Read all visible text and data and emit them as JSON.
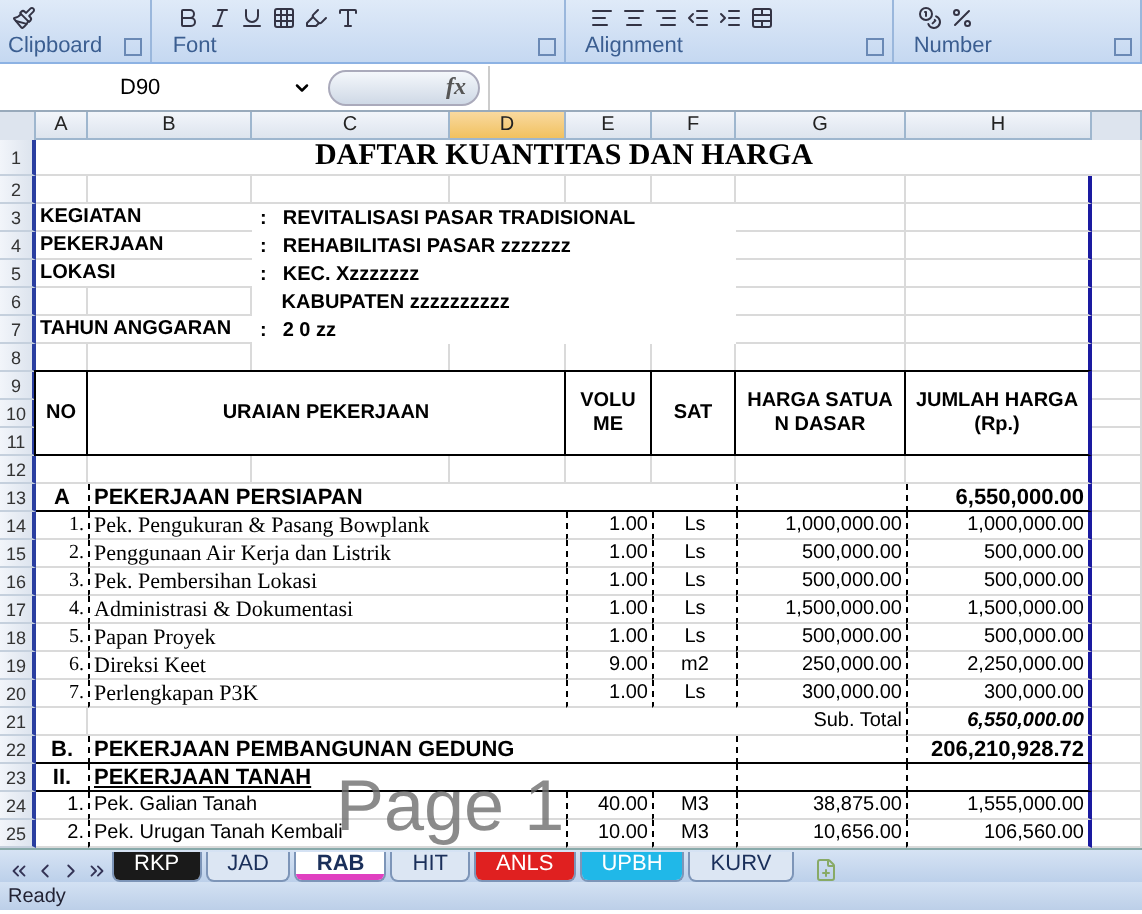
{
  "ribbon": {
    "groups": [
      {
        "label": "Clipboard"
      },
      {
        "label": "Font"
      },
      {
        "label": "Alignment"
      },
      {
        "label": "Number"
      }
    ]
  },
  "formula_bar": {
    "name_box": "D90",
    "function_label": "fx"
  },
  "columns": [
    {
      "label": "A",
      "selected": false
    },
    {
      "label": "B",
      "selected": false
    },
    {
      "label": "C",
      "selected": false
    },
    {
      "label": "D",
      "selected": true
    },
    {
      "label": "E",
      "selected": false
    },
    {
      "label": "F",
      "selected": false
    },
    {
      "label": "G",
      "selected": false
    },
    {
      "label": "H",
      "selected": false
    }
  ],
  "rows": [
    {
      "number": "1",
      "kind": "title",
      "text": "DAFTAR KUANTITAS DAN HARGA"
    },
    {
      "number": "2",
      "kind": "blank"
    },
    {
      "number": "3",
      "kind": "info",
      "label": "KEGIATAN",
      "separator": ":",
      "value": "REVITALISASI PASAR TRADISIONAL"
    },
    {
      "number": "4",
      "kind": "info",
      "label": "PEKERJAAN",
      "separator": ":",
      "value": "REHABILITASI PASAR zzzzzzz"
    },
    {
      "number": "5",
      "kind": "info",
      "label": "LOKASI",
      "separator": ":",
      "value": "KEC. Xzzzzzzz"
    },
    {
      "number": "6",
      "kind": "info",
      "value": "KABUPATEN zzzzzzzzzz"
    },
    {
      "number": "7",
      "kind": "info",
      "label": "TAHUN ANGGARAN",
      "separator": ":",
      "value": "2 0 zz"
    },
    {
      "number": "8",
      "kind": "blank"
    },
    {
      "numbers": [
        "9",
        "10",
        "11"
      ],
      "kind": "header",
      "no": "NO",
      "description": "URAIAN PEKERJAAN",
      "volume": "VOLUME",
      "unit": "SAT",
      "price": "HARGA SATUAN DASAR",
      "amount": "JUMLAH HARGA (Rp.)"
    },
    {
      "number": "12",
      "kind": "blank"
    },
    {
      "number": "13",
      "kind": "section",
      "no": "A",
      "text": "PEKERJAAN PERSIAPAN",
      "amount": "6,550,000.00"
    },
    {
      "number": "14",
      "kind": "item",
      "no": "1.",
      "description": "Pek. Pengukuran & Pasang Bowplank",
      "volume": "1.00",
      "unit": "Ls",
      "price": "1,000,000.00",
      "amount": "1,000,000.00"
    },
    {
      "number": "15",
      "kind": "item",
      "no": "2.",
      "description": "Penggunaan Air Kerja dan Listrik",
      "volume": "1.00",
      "unit": "Ls",
      "price": "500,000.00",
      "amount": "500,000.00"
    },
    {
      "number": "16",
      "kind": "item",
      "no": "3.",
      "description": "Pek. Pembersihan Lokasi",
      "volume": "1.00",
      "unit": "Ls",
      "price": "500,000.00",
      "amount": "500,000.00"
    },
    {
      "number": "17",
      "kind": "item",
      "no": "4.",
      "description": "Administrasi & Dokumentasi",
      "volume": "1.00",
      "unit": "Ls",
      "price": "1,500,000.00",
      "amount": "1,500,000.00"
    },
    {
      "number": "18",
      "kind": "item",
      "no": "5.",
      "description": "Papan Proyek",
      "volume": "1.00",
      "unit": "Ls",
      "price": "500,000.00",
      "amount": "500,000.00"
    },
    {
      "number": "19",
      "kind": "item",
      "no": "6.",
      "description": "Direksi Keet",
      "volume": "9.00",
      "unit": "m2",
      "price": "250,000.00",
      "amount": "2,250,000.00"
    },
    {
      "number": "20",
      "kind": "item",
      "no": "7.",
      "description": "Perlengkapan P3K",
      "volume": "1.00",
      "unit": "Ls",
      "price": "300,000.00",
      "amount": "300,000.00"
    },
    {
      "number": "21",
      "kind": "subtotal",
      "caption": "Sub. Total",
      "amount": "6,550,000.00"
    },
    {
      "number": "22",
      "kind": "section",
      "no": "B.",
      "text": "PEKERJAAN PEMBANGUNAN GEDUNG",
      "amount": "206,210,928.72"
    },
    {
      "number": "23",
      "kind": "subsection",
      "no": "II.",
      "text": "PEKERJAAN TANAH"
    },
    {
      "number": "24",
      "kind": "plain_item",
      "no": "1.",
      "description": "Pek. Galian Tanah",
      "volume": "40.00",
      "unit": "M3",
      "price": "38,875.00",
      "amount": "1,555,000.00"
    },
    {
      "number": "25",
      "kind": "plain_item",
      "no": "2.",
      "description": "Pek. Urugan Tanah Kembali",
      "volume": "10.00",
      "unit": "M3",
      "price": "10,656.00",
      "amount": "106,560.00"
    }
  ],
  "page_label": "Page 1",
  "sheet_tabs": [
    {
      "label": "RKP",
      "selected": false,
      "color": "#1a1a1a"
    },
    {
      "label": "JAD",
      "selected": false
    },
    {
      "label": "RAB",
      "selected": true,
      "color": "#e040c0"
    },
    {
      "label": "HIT",
      "selected": false
    },
    {
      "label": "ANLS",
      "selected": false,
      "color": "#e02020"
    },
    {
      "label": "UPBH",
      "selected": false,
      "color": "#20b8e8"
    },
    {
      "label": "KURV",
      "selected": false
    }
  ],
  "status": "Ready"
}
